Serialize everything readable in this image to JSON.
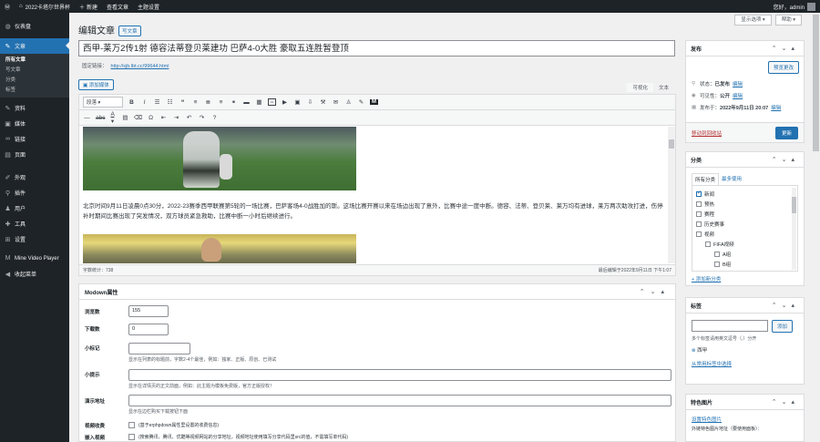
{
  "adminbar": {
    "wp_icon": "wordpress-icon",
    "site_name": "2022卡塔尔世界杯",
    "new_label": "新建",
    "view_post_label": "查看文章",
    "theme_settings_label": "主题设置",
    "greeting": "您好，admin"
  },
  "sidebar": {
    "items": [
      {
        "icon": "dashboard-icon",
        "label": "仪表盘"
      },
      {
        "icon": "pin-icon",
        "label": "文章"
      },
      {
        "icon": "pin-icon",
        "label": "资料"
      },
      {
        "icon": "media-icon",
        "label": "媒体"
      },
      {
        "icon": "link-icon",
        "label": "链接"
      },
      {
        "icon": "page-icon",
        "label": "页面"
      },
      {
        "icon": "comment-icon",
        "label": "评论"
      },
      {
        "icon": "brush-icon",
        "label": "外观"
      },
      {
        "icon": "plugin-icon",
        "label": "插件"
      },
      {
        "icon": "user-icon",
        "label": "用户"
      },
      {
        "icon": "tool-icon",
        "label": "工具"
      },
      {
        "icon": "settings-icon",
        "label": "设置"
      },
      {
        "icon": "video-icon",
        "label": "Mine Video Player"
      },
      {
        "icon": "collapse-icon",
        "label": "收起菜单"
      }
    ],
    "sub": [
      "所有文章",
      "写文章",
      "分类",
      "标签"
    ]
  },
  "screen_options": "显示选项",
  "help": "帮助",
  "page_title": "编辑文章",
  "write_btn": "写文章",
  "post_title": "西甲-莱万2传1射 德容法蒂登贝莱建功 巴萨4-0大胜 豪取五连胜暂登顶",
  "permalink_label": "固定链接：",
  "permalink_url": "http://sjb.lbt.cc/99644.html",
  "add_media": "添加媒体",
  "editor_tabs": {
    "visual": "可视化",
    "text": "文本"
  },
  "toolbar": {
    "format": "段落"
  },
  "body_text": "北京时间9月11日凌晨0点30分，2022-23赛季西甲联赛第5轮的一场比赛，巴萨客场4-0战胜加的斯。这场比赛开赛以来在场边出现了意外，比赛中途一度中断。德容、法蒂、登贝莱、莱万均有进球，莱万两次助攻打进，伤停补时期间比赛出现了突发情况，双方球员紧急救助，比赛中断一小时后继续进行。",
  "p_tag": "p",
  "word_count": "字数统计：738",
  "last_edited": "最后编辑于2022年9月11日 下午1:07",
  "modown": {
    "title": "Modown属性",
    "fields": [
      {
        "label": "浏览数",
        "value": "155"
      },
      {
        "label": "下载数",
        "value": "0"
      },
      {
        "label": "小标记",
        "value": "",
        "desc": "显示在列表的标题前，字数2-4个最佳，例如：独家、正版、原创、已测试"
      },
      {
        "label": "小提示",
        "value": "",
        "desc": "显示在详情页的正文前面，例如：此主题为模板免费版，官方正版授权！"
      },
      {
        "label": "演示地址",
        "value": "",
        "desc": "显示在边栏购买下载按钮下面"
      },
      {
        "label": "视频收费",
        "desc": "(基于erphpdown属性里设置的收费信息)"
      },
      {
        "label": "嵌入视频",
        "desc": "(搜索腾讯、腾讯、优酷等视频网站的分享地址，视频地址使用填写分享代码里src的值，不需填写单代码)"
      }
    ]
  },
  "publish": {
    "title": "发布",
    "preview": "预览更改",
    "status_label": "状态：",
    "status": "已发布",
    "visibility_label": "可见性：",
    "visibility": "公开",
    "published_label": "发布于：",
    "published": "2022年9月11日 20:07",
    "edit": "编辑",
    "trash": "移动到回收站",
    "update": "更新"
  },
  "categories": {
    "title": "分类",
    "tab_all": "所有分类",
    "tab_popular": "最多使用",
    "items": [
      {
        "label": "新闻",
        "checked": true,
        "indent": 0
      },
      {
        "label": "预热",
        "checked": false,
        "indent": 0
      },
      {
        "label": "赛程",
        "checked": false,
        "indent": 0
      },
      {
        "label": "历史赛事",
        "checked": false,
        "indent": 0
      },
      {
        "label": "视频",
        "checked": false,
        "indent": 0
      },
      {
        "label": "FIFA视频",
        "checked": false,
        "indent": 1
      },
      {
        "label": "A组",
        "checked": false,
        "indent": 2
      },
      {
        "label": "B组",
        "checked": false,
        "indent": 2
      }
    ],
    "add_new": "+ 添加新分类"
  },
  "tags": {
    "title": "标签",
    "add_btn": "添加",
    "hint": "多个标签请用英文逗号（,）分开",
    "tag": "西甲",
    "choose": "从常用标签中选择"
  },
  "featured": {
    "title": "特色图片",
    "set_link": "设置特色图片",
    "external": "外链特色图片地址（要使用面板）："
  }
}
